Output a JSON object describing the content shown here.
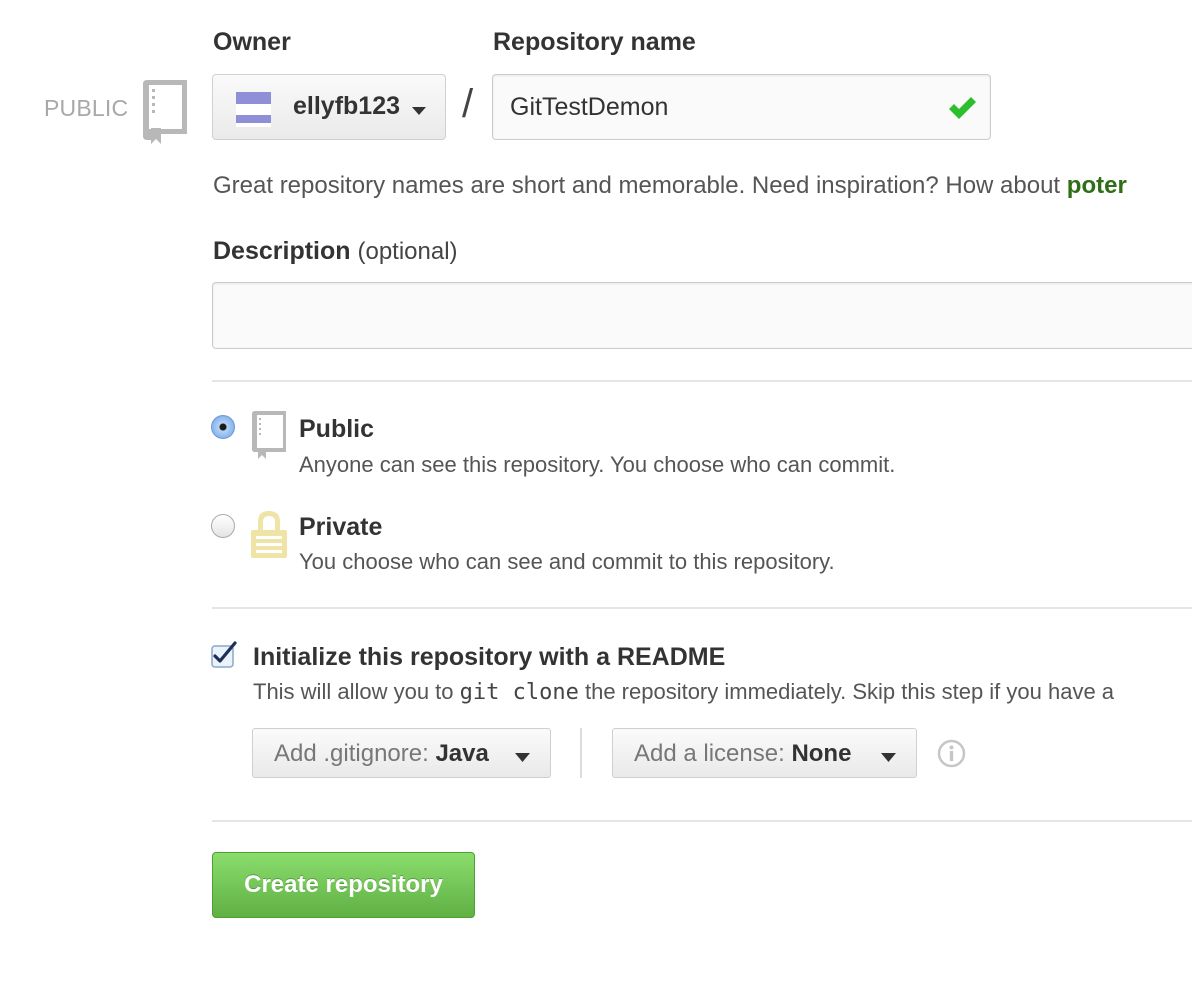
{
  "visibility_tag": "PUBLIC",
  "owner": {
    "label": "Owner",
    "value": "ellyfb123",
    "avatar_color": "#8f8fd8"
  },
  "separator": "/",
  "repository_name": {
    "label": "Repository name",
    "value": "GitTestDemon",
    "valid": true
  },
  "name_hint": {
    "text": "Great repository names are short and memorable. Need inspiration? How about ",
    "suggestion": "poter"
  },
  "description": {
    "label": "Description",
    "optional_text": "(optional)",
    "value": ""
  },
  "visibility": {
    "selected": "public",
    "options": [
      {
        "id": "public",
        "title": "Public",
        "description": "Anyone can see this repository. You choose who can commit.",
        "icon": "repo-book-icon"
      },
      {
        "id": "private",
        "title": "Private",
        "description": "You choose who can see and commit to this repository.",
        "icon": "lock-icon"
      }
    ]
  },
  "readme": {
    "checked": true,
    "title": "Initialize this repository with a README",
    "desc_before": "This will allow you to ",
    "desc_code": "git clone",
    "desc_after": " the repository immediately. Skip this step if you have a"
  },
  "gitignore": {
    "label": "Add .gitignore: ",
    "value": "Java"
  },
  "license": {
    "label": "Add a license: ",
    "value": "None"
  },
  "create_button_label": "Create repository",
  "colors": {
    "success_green": "#2cbe2c",
    "button_green": "#60b044",
    "suggestion_green": "#2f6e17",
    "radio_selected": "#7fb0ea",
    "lock_yellow": "#f0e3a6"
  }
}
